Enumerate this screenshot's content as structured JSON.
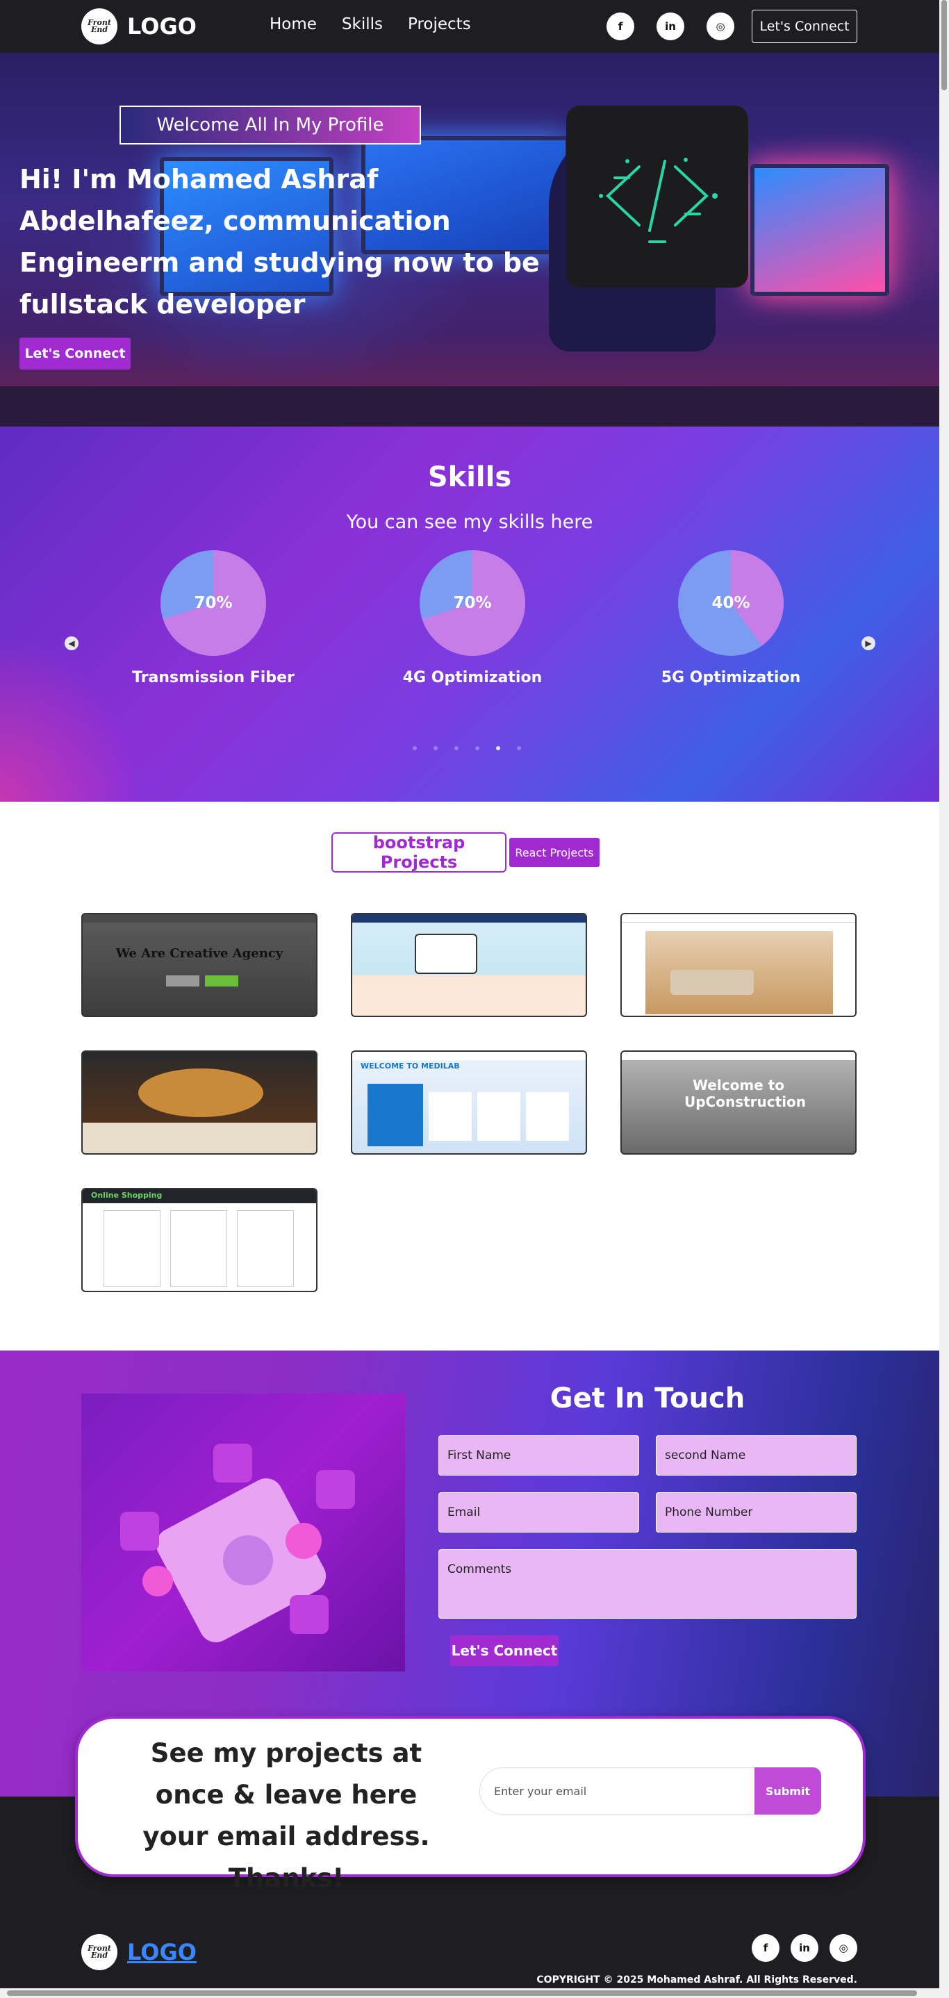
{
  "nav": {
    "brand_badge": "Front End",
    "brand_text": "LOGO",
    "links": [
      "Home",
      "Skills",
      "Projects"
    ],
    "socials": [
      {
        "icon": "facebook-icon",
        "glyph": "f"
      },
      {
        "icon": "linkedin-icon",
        "glyph": "in"
      },
      {
        "icon": "instagram-icon",
        "glyph": "◎"
      }
    ],
    "cta": "Let's Connect"
  },
  "hero": {
    "tagline": "Welcome All In My Profile",
    "title": "Hi! I'm Mohamed Ashraf Abdelhafeez, communication Engineerm and studying now to be fullstack developer",
    "cta": "Let's Connect"
  },
  "skills": {
    "title": "Skills",
    "subtitle": "You can see my skills here",
    "items": [
      {
        "name": "Transmission Fiber",
        "percent_label": "70%",
        "value": 70
      },
      {
        "name": "4G Optimization",
        "percent_label": "70%",
        "value": 70
      },
      {
        "name": "5G Optimization",
        "percent_label": "40%",
        "value": 40
      }
    ],
    "carousel_dots": 6,
    "active_dot": 4,
    "colors": {
      "pie_fill": "#c77de8",
      "pie_remainder": "#7b9cf0"
    }
  },
  "projects": {
    "tabs": [
      "bootstrap Projects",
      "React Projects"
    ],
    "active_tab": 0,
    "cards": [
      {
        "name": "creative-agency",
        "caption": "We Are Creative Agency"
      },
      {
        "name": "clothes-shop",
        "caption": ""
      },
      {
        "name": "furniture-store",
        "caption": ""
      },
      {
        "name": "pizza-restaurant",
        "caption": ""
      },
      {
        "name": "medilab",
        "caption": "WELCOME TO MEDILAB"
      },
      {
        "name": "upconstruction",
        "caption": "Welcome to UpConstruction"
      },
      {
        "name": "online-shopping",
        "caption": "Online Shopping"
      }
    ]
  },
  "contact": {
    "title": "Get In Touch",
    "fields": {
      "first_name": "First Name",
      "second_name": "second Name",
      "email": "Email",
      "phone": "Phone Number",
      "comments": "Comments"
    },
    "cta": "Let's Connect"
  },
  "newsletter": {
    "text": "See my projects at once & leave here your email address. Thanks!",
    "placeholder": "Enter your email",
    "submit": "Submit"
  },
  "footer": {
    "brand_text": "LOGO",
    "copyright": "COPYRIGHT © 2025 Mohamed Ashraf. All Rights Reserved."
  }
}
